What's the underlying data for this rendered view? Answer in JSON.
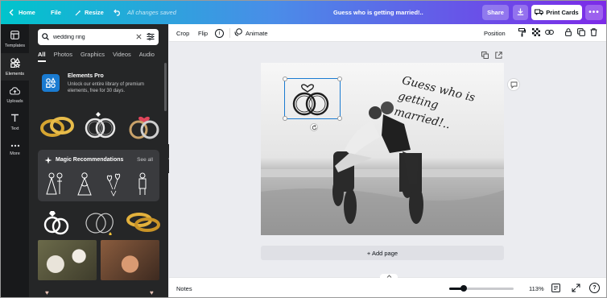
{
  "topbar": {
    "home": "Home",
    "file": "File",
    "resize": "Resize",
    "status": "All changes saved",
    "doc_title": "Guess who is getting married!..",
    "share": "Share",
    "print": "Print Cards",
    "more": "•••"
  },
  "rail": {
    "items": [
      {
        "label": "Templates",
        "icon": "templates-icon"
      },
      {
        "label": "Elements",
        "icon": "elements-icon"
      },
      {
        "label": "Uploads",
        "icon": "upload-icon"
      },
      {
        "label": "Text",
        "icon": "text-icon"
      },
      {
        "label": "More",
        "icon": "more-icon"
      }
    ]
  },
  "panel": {
    "search_value": "wedding ring",
    "tabs": [
      "All",
      "Photos",
      "Graphics",
      "Videos",
      "Audio"
    ],
    "promo_title": "Elements Pro",
    "promo_desc": "Unlock our entire library of premium elements, free for 30 days.",
    "magic_title": "Magic Recommendations",
    "magic_see_all": "See all"
  },
  "toolbar": {
    "crop": "Crop",
    "flip": "Flip",
    "info": "i",
    "animate": "Animate",
    "position": "Position"
  },
  "canvas": {
    "card_text": "Guess who is getting married!..",
    "add_page": "+ Add page"
  },
  "bottombar": {
    "notes": "Notes",
    "zoom_label": "113%",
    "zoom_level": 0.22,
    "help": "?"
  },
  "colors": {
    "brand_gradient_start": "#00c4cc",
    "brand_gradient_end": "#7d2ae8",
    "selection": "#1a7bd1",
    "gold": "#d6a531"
  }
}
